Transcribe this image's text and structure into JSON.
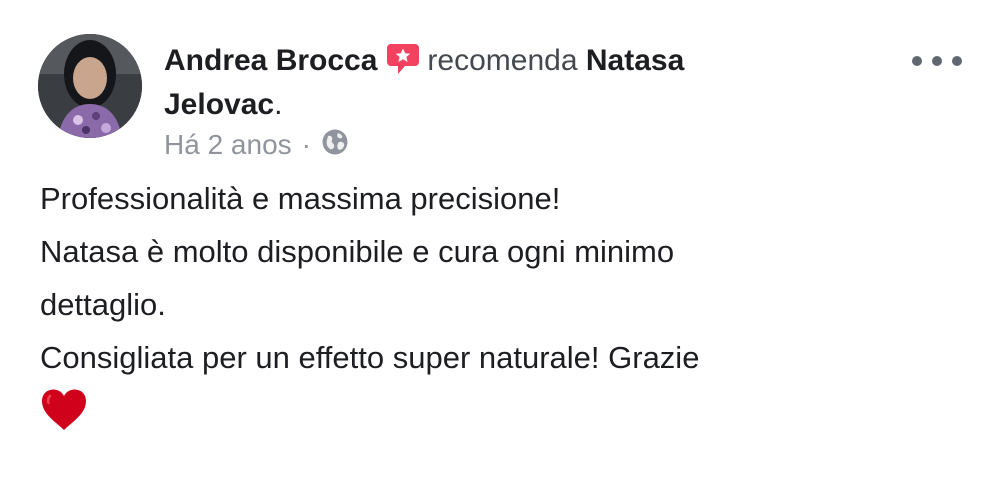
{
  "post": {
    "author": "Andrea Brocca",
    "action": "recomenda",
    "target_line1": "Natasa",
    "target_line2": "Jelovac",
    "target_suffix": ".",
    "timestamp": "Há 2 anos",
    "separator": "·",
    "privacy_icon": "globe-icon",
    "badge_icon": "recommendation-star-icon",
    "menu_icon": "more-options-icon",
    "body_lines": [
      "Professionalità e massima precisione!",
      "Natasa è molto disponibile e cura ogni minimo",
      "dettaglio.",
      "Consigliata per un effetto super naturale! Grazie"
    ],
    "trailing_emoji": "heart-icon"
  },
  "colors": {
    "badge": "#f3425f",
    "heart": "#d0021b",
    "meta_text": "#90949c",
    "name_text": "#1c1e21"
  }
}
